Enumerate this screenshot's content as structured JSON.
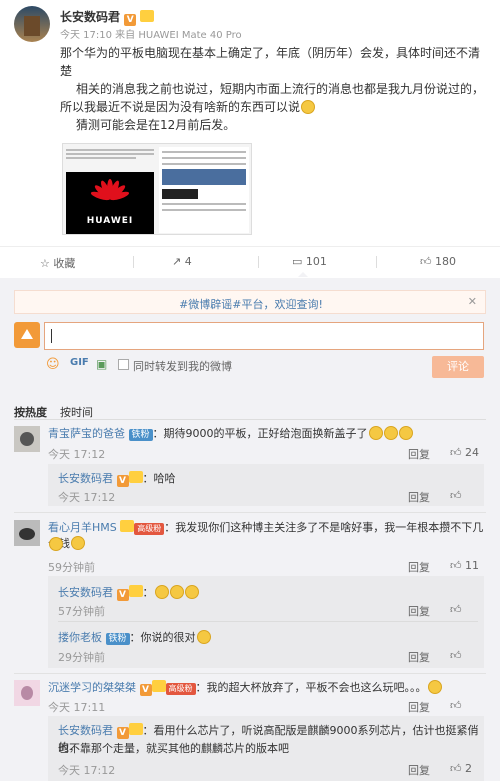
{
  "post": {
    "author": "长安数码君",
    "meta": "今天 17:10 来自 HUAWEI Mate 40 Pro",
    "para1": "那个华为的平板电脑现在基本上确定了，年底（阴历年）会发，具体时间还不清",
    "para1b": "楚",
    "para2": "相关的消息我之前也说过，短期内市面上流行的消息也都是我九月份说过的，",
    "para2b": "所以我最近不说是因为没有啥新的东西可以说",
    "para3": "猜测可能会是在12月前后发。",
    "image_logo_text": "HUAWEI"
  },
  "actions": {
    "favorite": "收藏",
    "repost": "4",
    "comment": "101",
    "like": "180"
  },
  "notice": "#微博辟谣#平台，欢迎查询!",
  "composer": {
    "repost_label": "同时转发到我的微博",
    "submit": "评论"
  },
  "sort": {
    "hot": "按热度",
    "time": "按时间"
  },
  "comments": [
    {
      "user": "青宝萨宝的爸爸",
      "badge": "铁粉",
      "text": "：期待9000的平板，正好给泡面换新盖子了",
      "time": "今天 17:12",
      "likes": "24",
      "replies": [
        {
          "user": "长安数码君",
          "text": "：哈哈",
          "time": "今天 17:12",
          "reply": "回复"
        }
      ]
    },
    {
      "user": "看心月羊HMS",
      "badge": "高级粉",
      "text": "：我发现你们这种博主关注多了不是啥好事，我一年根本攒不下几个钱",
      "time": "59分钟前",
      "likes": "11",
      "replies": [
        {
          "user": "长安数码君",
          "text": "：",
          "time": "57分钟前",
          "reply": "回复"
        },
        {
          "user": "搂你老板",
          "badge": "铁粉",
          "text": "：你说的很对",
          "time": "29分钟前",
          "reply": "回复"
        }
      ]
    },
    {
      "user": "沉迷学习的桀桀桀",
      "badge": "高级粉",
      "text": "：我的超大杯放弃了，平板不会也这么玩吧。。。",
      "time": "今天 17:11",
      "likes": "",
      "replies": [
        {
          "user": "长安数码君",
          "text": "：看用什么芯片了，听说高配版是麒麟9000系列芯片，估计也挺紧俏的，",
          "text2": "也不靠那个走量，就买其他的麒麟芯片的版本吧",
          "time": "今天 17:12",
          "reply": "回复",
          "likes": "2"
        }
      ]
    }
  ],
  "reply_label": "回复",
  "colors": {
    "accent": "#eb7350",
    "link": "#4a7cae",
    "bg_gray": "#f2f2f5"
  }
}
